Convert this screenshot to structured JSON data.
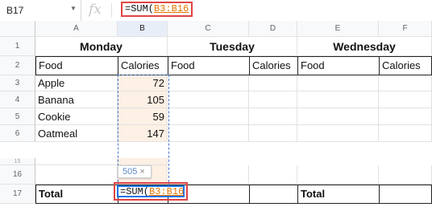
{
  "name_box": "B17",
  "fx_label": "fx",
  "formula": {
    "prefix": "=SUM(",
    "range": "B3:B16"
  },
  "columns": [
    "A",
    "B",
    "C",
    "D",
    "E",
    "F"
  ],
  "rows_visible": [
    "1",
    "2",
    "3",
    "4",
    "5",
    "6",
    "15",
    "16",
    "17"
  ],
  "days": {
    "monday": "Monday",
    "tuesday": "Tuesday",
    "wednesday": "Wednesday"
  },
  "headers": {
    "food": "Food",
    "calories": "Calories"
  },
  "foods": [
    {
      "name": "Apple",
      "calories": "72"
    },
    {
      "name": "Banana",
      "calories": "105"
    },
    {
      "name": "Cookie",
      "calories": "59"
    },
    {
      "name": "Oatmeal",
      "calories": "147"
    }
  ],
  "tooltip": {
    "value": "505",
    "close": "×"
  },
  "total_label": "Total",
  "overflow_char": "a",
  "colors": {
    "accent_red": "#e04444",
    "selection_blue": "#1a73e8",
    "highlight": "#fdf0e4",
    "ref_orange": "#e37400"
  }
}
